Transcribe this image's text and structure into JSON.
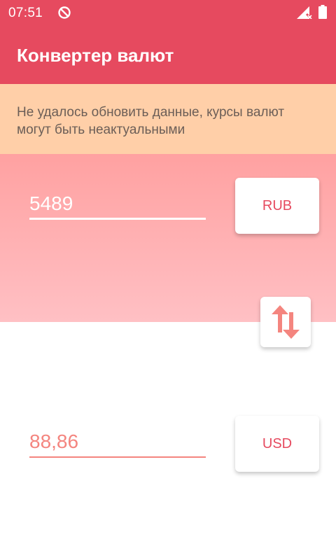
{
  "status_bar": {
    "time": "07:51",
    "icons": [
      "sync-off-icon",
      "signal-icon",
      "battery-icon"
    ]
  },
  "app_bar": {
    "title": "Конвертер валют"
  },
  "warning": {
    "text": "Не удалось обновить данные, курсы валют могут быть неактуальными"
  },
  "converter": {
    "from": {
      "value": "5489",
      "currency": "RUB"
    },
    "to": {
      "value": "88,86",
      "currency": "USD"
    },
    "swap_icon": "swap-vertical-icon"
  },
  "colors": {
    "primary": "#e64a5f",
    "warning_bg": "#ffcfa8",
    "gradient_top": "#ffa1a1",
    "gradient_bottom": "#ffc0c4",
    "accent": "#f4857f"
  }
}
